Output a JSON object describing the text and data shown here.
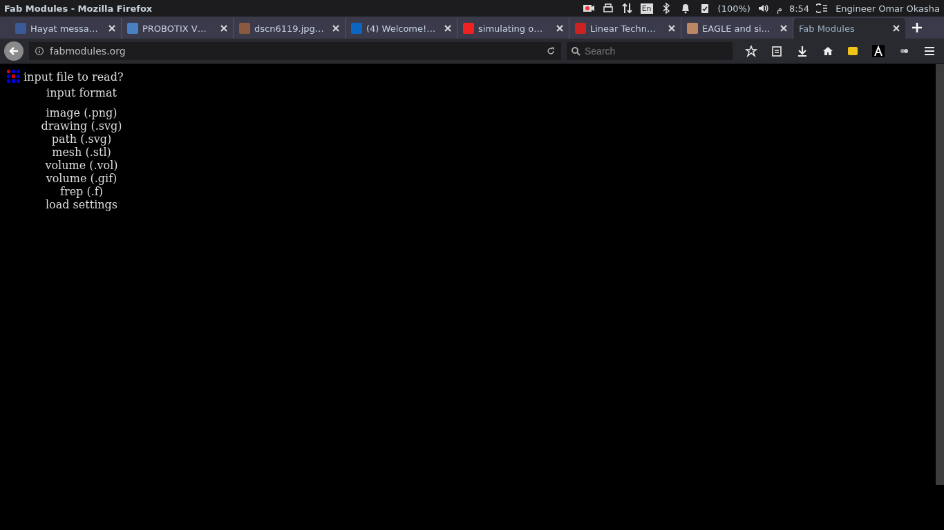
{
  "window": {
    "title": "Fab Modules - Mozilla Firefox"
  },
  "panel": {
    "keyboard": "En",
    "battery": "(100%)",
    "time_suffix": "م",
    "time": "8:54",
    "user": "Engineer Omar Okasha"
  },
  "tabs": [
    {
      "label": "Hayat messa…",
      "selected": false
    },
    {
      "label": "PROBOTIX V…",
      "selected": false
    },
    {
      "label": "dscn6119.jpg…",
      "selected": false
    },
    {
      "label": "(4) Welcome!…",
      "selected": false
    },
    {
      "label": "simulating o…",
      "selected": false
    },
    {
      "label": "Linear Techn…",
      "selected": false
    },
    {
      "label": "EAGLE and si…",
      "selected": false
    },
    {
      "label": "Fab Modules",
      "selected": true
    }
  ],
  "address_bar": {
    "url": "fabmodules.org"
  },
  "search": {
    "placeholder": "Search"
  },
  "page": {
    "prompt": "input file to read?",
    "heading": "input format",
    "options": [
      "image (.png)",
      "drawing (.svg)",
      "path (.svg)",
      "mesh (.stl)",
      "volume (.vol)",
      "volume (.gif)",
      "frep (.f)",
      "load settings"
    ]
  }
}
